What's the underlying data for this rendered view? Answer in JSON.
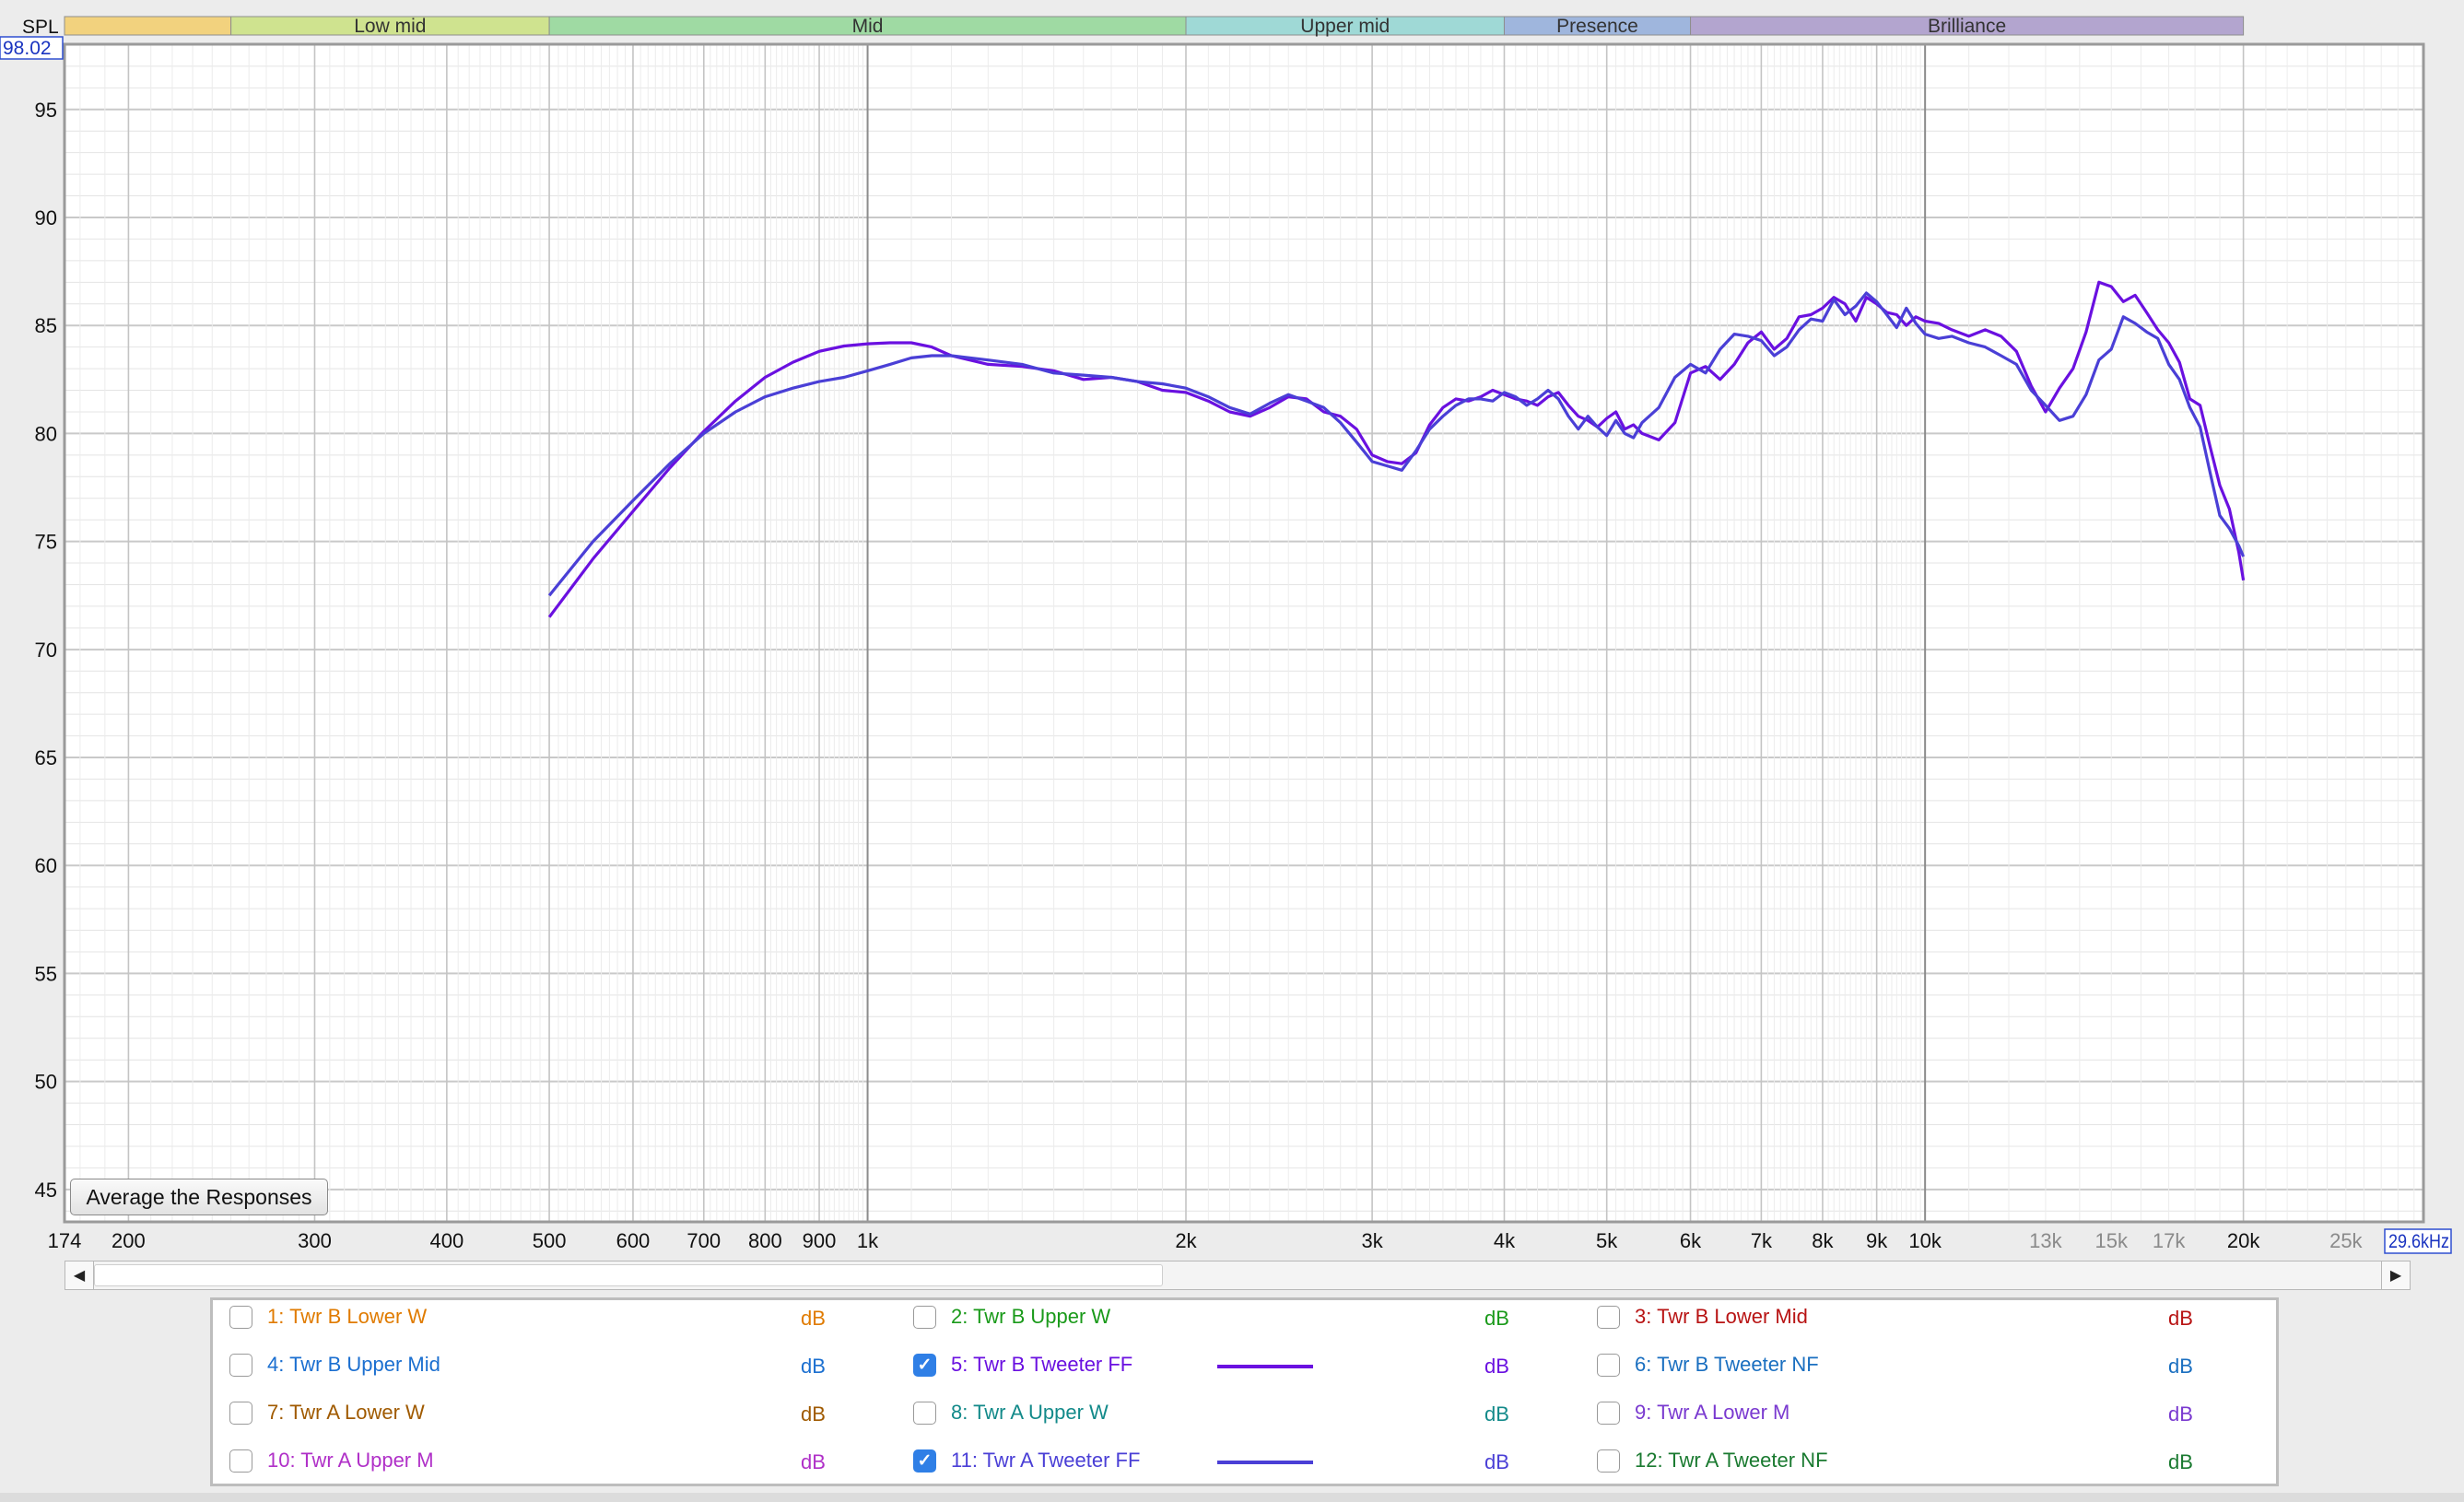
{
  "header": {
    "spl_label": "SPL",
    "ymax_readout": "98.02",
    "xmax_readout": "29.6kHz"
  },
  "bands": [
    {
      "label": "",
      "color": "#f2d27e",
      "from": 150,
      "to": 250
    },
    {
      "label": "Low mid",
      "color": "#cfe38f",
      "from": 250,
      "to": 500
    },
    {
      "label": "Mid",
      "color": "#9fdaa3",
      "from": 500,
      "to": 2000
    },
    {
      "label": "Upper mid",
      "color": "#9fd9d6",
      "from": 2000,
      "to": 4000
    },
    {
      "label": "Presence",
      "color": "#9fb6dd",
      "from": 4000,
      "to": 6000
    },
    {
      "label": "Brilliance",
      "color": "#b3a5cf",
      "from": 6000,
      "to": 20000
    }
  ],
  "chart_data": {
    "type": "line",
    "title": "",
    "xlabel": "",
    "ylabel": "SPL",
    "x_scale": "log",
    "xlim": [
      174,
      29600
    ],
    "ylim": [
      43.5,
      98.02
    ],
    "grid": true,
    "x_ticks": [
      {
        "v": 174,
        "label": "174"
      },
      {
        "v": 200,
        "label": "200"
      },
      {
        "v": 300,
        "label": "300"
      },
      {
        "v": 400,
        "label": "400"
      },
      {
        "v": 500,
        "label": "500"
      },
      {
        "v": 600,
        "label": "600"
      },
      {
        "v": 700,
        "label": "700"
      },
      {
        "v": 800,
        "label": "800"
      },
      {
        "v": 900,
        "label": "900"
      },
      {
        "v": 1000,
        "label": "1k"
      },
      {
        "v": 2000,
        "label": "2k"
      },
      {
        "v": 3000,
        "label": "3k"
      },
      {
        "v": 4000,
        "label": "4k"
      },
      {
        "v": 5000,
        "label": "5k"
      },
      {
        "v": 6000,
        "label": "6k"
      },
      {
        "v": 7000,
        "label": "7k"
      },
      {
        "v": 8000,
        "label": "8k"
      },
      {
        "v": 9000,
        "label": "9k"
      },
      {
        "v": 10000,
        "label": "10k"
      },
      {
        "v": 13000,
        "label": "13k",
        "muted": true
      },
      {
        "v": 15000,
        "label": "15k",
        "muted": true
      },
      {
        "v": 17000,
        "label": "17k",
        "muted": true
      },
      {
        "v": 20000,
        "label": "20k"
      },
      {
        "v": 25000,
        "label": "25k",
        "muted": true
      }
    ],
    "y_ticks": [
      45,
      50,
      55,
      60,
      65,
      70,
      75,
      80,
      85,
      90,
      95
    ],
    "series": [
      {
        "name": "5: Twr B Tweeter FF",
        "color": "#6a10e0",
        "points": [
          [
            500,
            71.5
          ],
          [
            550,
            74.2
          ],
          [
            600,
            76.4
          ],
          [
            650,
            78.4
          ],
          [
            700,
            80.1
          ],
          [
            750,
            81.5
          ],
          [
            800,
            82.6
          ],
          [
            850,
            83.3
          ],
          [
            900,
            83.8
          ],
          [
            950,
            84.05
          ],
          [
            1000,
            84.15
          ],
          [
            1050,
            84.2
          ],
          [
            1100,
            84.2
          ],
          [
            1150,
            84.0
          ],
          [
            1200,
            83.6
          ],
          [
            1300,
            83.2
          ],
          [
            1400,
            83.1
          ],
          [
            1500,
            82.9
          ],
          [
            1600,
            82.5
          ],
          [
            1700,
            82.6
          ],
          [
            1800,
            82.4
          ],
          [
            1900,
            82.0
          ],
          [
            2000,
            81.9
          ],
          [
            2100,
            81.5
          ],
          [
            2200,
            81.0
          ],
          [
            2300,
            80.8
          ],
          [
            2400,
            81.2
          ],
          [
            2500,
            81.7
          ],
          [
            2600,
            81.6
          ],
          [
            2700,
            81.0
          ],
          [
            2800,
            80.8
          ],
          [
            2900,
            80.2
          ],
          [
            3000,
            79.0
          ],
          [
            3100,
            78.7
          ],
          [
            3200,
            78.6
          ],
          [
            3300,
            79.1
          ],
          [
            3400,
            80.4
          ],
          [
            3500,
            81.2
          ],
          [
            3600,
            81.6
          ],
          [
            3700,
            81.5
          ],
          [
            3800,
            81.7
          ],
          [
            3900,
            82.0
          ],
          [
            4000,
            81.8
          ],
          [
            4100,
            81.6
          ],
          [
            4200,
            81.5
          ],
          [
            4300,
            81.3
          ],
          [
            4400,
            81.7
          ],
          [
            4500,
            81.9
          ],
          [
            4600,
            81.3
          ],
          [
            4700,
            80.8
          ],
          [
            4800,
            80.6
          ],
          [
            4900,
            80.3
          ],
          [
            5000,
            80.7
          ],
          [
            5100,
            81.0
          ],
          [
            5200,
            80.2
          ],
          [
            5300,
            80.4
          ],
          [
            5400,
            80.0
          ],
          [
            5600,
            79.7
          ],
          [
            5800,
            80.5
          ],
          [
            6000,
            82.8
          ],
          [
            6200,
            83.1
          ],
          [
            6400,
            82.5
          ],
          [
            6600,
            83.2
          ],
          [
            6800,
            84.2
          ],
          [
            7000,
            84.7
          ],
          [
            7200,
            83.9
          ],
          [
            7400,
            84.4
          ],
          [
            7600,
            85.4
          ],
          [
            7800,
            85.5
          ],
          [
            8000,
            85.8
          ],
          [
            8200,
            86.3
          ],
          [
            8400,
            86.0
          ],
          [
            8600,
            85.2
          ],
          [
            8800,
            86.3
          ],
          [
            9000,
            86.0
          ],
          [
            9200,
            85.6
          ],
          [
            9400,
            85.5
          ],
          [
            9600,
            85.0
          ],
          [
            9800,
            85.4
          ],
          [
            10000,
            85.2
          ],
          [
            10300,
            85.1
          ],
          [
            10600,
            84.8
          ],
          [
            11000,
            84.5
          ],
          [
            11400,
            84.8
          ],
          [
            11800,
            84.5
          ],
          [
            12200,
            83.8
          ],
          [
            12600,
            82.2
          ],
          [
            13000,
            81.0
          ],
          [
            13400,
            82.1
          ],
          [
            13800,
            83.0
          ],
          [
            14200,
            84.7
          ],
          [
            14600,
            87.0
          ],
          [
            15000,
            86.8
          ],
          [
            15400,
            86.1
          ],
          [
            15800,
            86.4
          ],
          [
            16200,
            85.6
          ],
          [
            16600,
            84.8
          ],
          [
            17000,
            84.2
          ],
          [
            17400,
            83.3
          ],
          [
            17800,
            81.6
          ],
          [
            18200,
            81.3
          ],
          [
            18600,
            79.4
          ],
          [
            19000,
            77.6
          ],
          [
            19400,
            76.5
          ],
          [
            19800,
            74.5
          ],
          [
            20000,
            73.2
          ]
        ]
      },
      {
        "name": "11: Twr A Tweeter FF",
        "color": "#4a3fd6",
        "points": [
          [
            500,
            72.5
          ],
          [
            550,
            75.0
          ],
          [
            600,
            76.9
          ],
          [
            650,
            78.6
          ],
          [
            700,
            80.0
          ],
          [
            750,
            81.0
          ],
          [
            800,
            81.7
          ],
          [
            850,
            82.1
          ],
          [
            900,
            82.4
          ],
          [
            950,
            82.6
          ],
          [
            1000,
            82.9
          ],
          [
            1050,
            83.2
          ],
          [
            1100,
            83.5
          ],
          [
            1150,
            83.6
          ],
          [
            1200,
            83.6
          ],
          [
            1300,
            83.4
          ],
          [
            1400,
            83.2
          ],
          [
            1500,
            82.8
          ],
          [
            1600,
            82.7
          ],
          [
            1700,
            82.6
          ],
          [
            1800,
            82.4
          ],
          [
            1900,
            82.3
          ],
          [
            2000,
            82.1
          ],
          [
            2100,
            81.7
          ],
          [
            2200,
            81.2
          ],
          [
            2300,
            80.9
          ],
          [
            2400,
            81.4
          ],
          [
            2500,
            81.8
          ],
          [
            2600,
            81.5
          ],
          [
            2700,
            81.2
          ],
          [
            2800,
            80.5
          ],
          [
            2900,
            79.6
          ],
          [
            3000,
            78.7
          ],
          [
            3100,
            78.5
          ],
          [
            3200,
            78.3
          ],
          [
            3300,
            79.2
          ],
          [
            3400,
            80.2
          ],
          [
            3500,
            80.8
          ],
          [
            3600,
            81.3
          ],
          [
            3700,
            81.6
          ],
          [
            3800,
            81.6
          ],
          [
            3900,
            81.5
          ],
          [
            4000,
            81.9
          ],
          [
            4100,
            81.7
          ],
          [
            4200,
            81.3
          ],
          [
            4300,
            81.6
          ],
          [
            4400,
            82.0
          ],
          [
            4500,
            81.6
          ],
          [
            4600,
            80.8
          ],
          [
            4700,
            80.2
          ],
          [
            4800,
            80.8
          ],
          [
            4900,
            80.3
          ],
          [
            5000,
            79.9
          ],
          [
            5100,
            80.6
          ],
          [
            5200,
            80.0
          ],
          [
            5300,
            79.8
          ],
          [
            5400,
            80.5
          ],
          [
            5600,
            81.2
          ],
          [
            5800,
            82.6
          ],
          [
            6000,
            83.2
          ],
          [
            6200,
            82.8
          ],
          [
            6400,
            83.9
          ],
          [
            6600,
            84.6
          ],
          [
            6800,
            84.5
          ],
          [
            7000,
            84.3
          ],
          [
            7200,
            83.6
          ],
          [
            7400,
            84.0
          ],
          [
            7600,
            84.8
          ],
          [
            7800,
            85.3
          ],
          [
            8000,
            85.2
          ],
          [
            8200,
            86.2
          ],
          [
            8400,
            85.5
          ],
          [
            8600,
            85.9
          ],
          [
            8800,
            86.5
          ],
          [
            9000,
            86.1
          ],
          [
            9200,
            85.5
          ],
          [
            9400,
            84.9
          ],
          [
            9600,
            85.8
          ],
          [
            9800,
            85.1
          ],
          [
            10000,
            84.6
          ],
          [
            10300,
            84.4
          ],
          [
            10600,
            84.5
          ],
          [
            11000,
            84.2
          ],
          [
            11400,
            84.0
          ],
          [
            11800,
            83.6
          ],
          [
            12200,
            83.2
          ],
          [
            12600,
            82.0
          ],
          [
            13000,
            81.3
          ],
          [
            13400,
            80.6
          ],
          [
            13800,
            80.8
          ],
          [
            14200,
            81.8
          ],
          [
            14600,
            83.4
          ],
          [
            15000,
            83.9
          ],
          [
            15400,
            85.4
          ],
          [
            15800,
            85.1
          ],
          [
            16200,
            84.7
          ],
          [
            16600,
            84.4
          ],
          [
            17000,
            83.2
          ],
          [
            17400,
            82.5
          ],
          [
            17800,
            81.2
          ],
          [
            18200,
            80.3
          ],
          [
            18600,
            78.2
          ],
          [
            19000,
            76.2
          ],
          [
            19400,
            75.6
          ],
          [
            19800,
            74.8
          ],
          [
            20000,
            74.3
          ]
        ]
      }
    ]
  },
  "average_button": {
    "label": "Average the Responses"
  },
  "scrollbar": {
    "left_arrow": "◀",
    "right_arrow": "▶"
  },
  "legend": {
    "columns": [
      [
        {
          "label": "1: Twr B Lower W",
          "unit": "dB",
          "color": "#e07b00",
          "checked": false
        },
        {
          "label": "4: Twr B Upper Mid",
          "unit": "dB",
          "color": "#1b6fd0",
          "checked": false
        },
        {
          "label": "7: Twr A Lower W",
          "unit": "dB",
          "color": "#a05a00",
          "checked": false
        },
        {
          "label": "10: Twr A Upper M",
          "unit": "dB",
          "color": "#b030c8",
          "checked": false
        }
      ],
      [
        {
          "label": "2: Twr B Upper W",
          "unit": "dB",
          "color": "#1a9a1a",
          "checked": false
        },
        {
          "label": "5: Twr B Tweeter FF",
          "unit": "dB",
          "color": "#6a10e0",
          "checked": true,
          "check_mark": "✓"
        },
        {
          "label": "8: Twr A Upper W",
          "unit": "dB",
          "color": "#138a8a",
          "checked": false
        },
        {
          "label": "11: Twr A Tweeter FF",
          "unit": "dB",
          "color": "#4a3fd6",
          "checked": true,
          "check_mark": "✓"
        }
      ],
      [
        {
          "label": "3: Twr B Lower Mid",
          "unit": "dB",
          "color": "#b81414",
          "checked": false
        },
        {
          "label": "6: Twr B Tweeter NF",
          "unit": "dB",
          "color": "#1a6fc0",
          "checked": false
        },
        {
          "label": "9: Twr A Lower M",
          "unit": "dB",
          "color": "#7a3ad0",
          "checked": false
        },
        {
          "label": "12: Twr A Tweeter NF",
          "unit": "dB",
          "color": "#1a7a30",
          "checked": false
        }
      ]
    ]
  }
}
